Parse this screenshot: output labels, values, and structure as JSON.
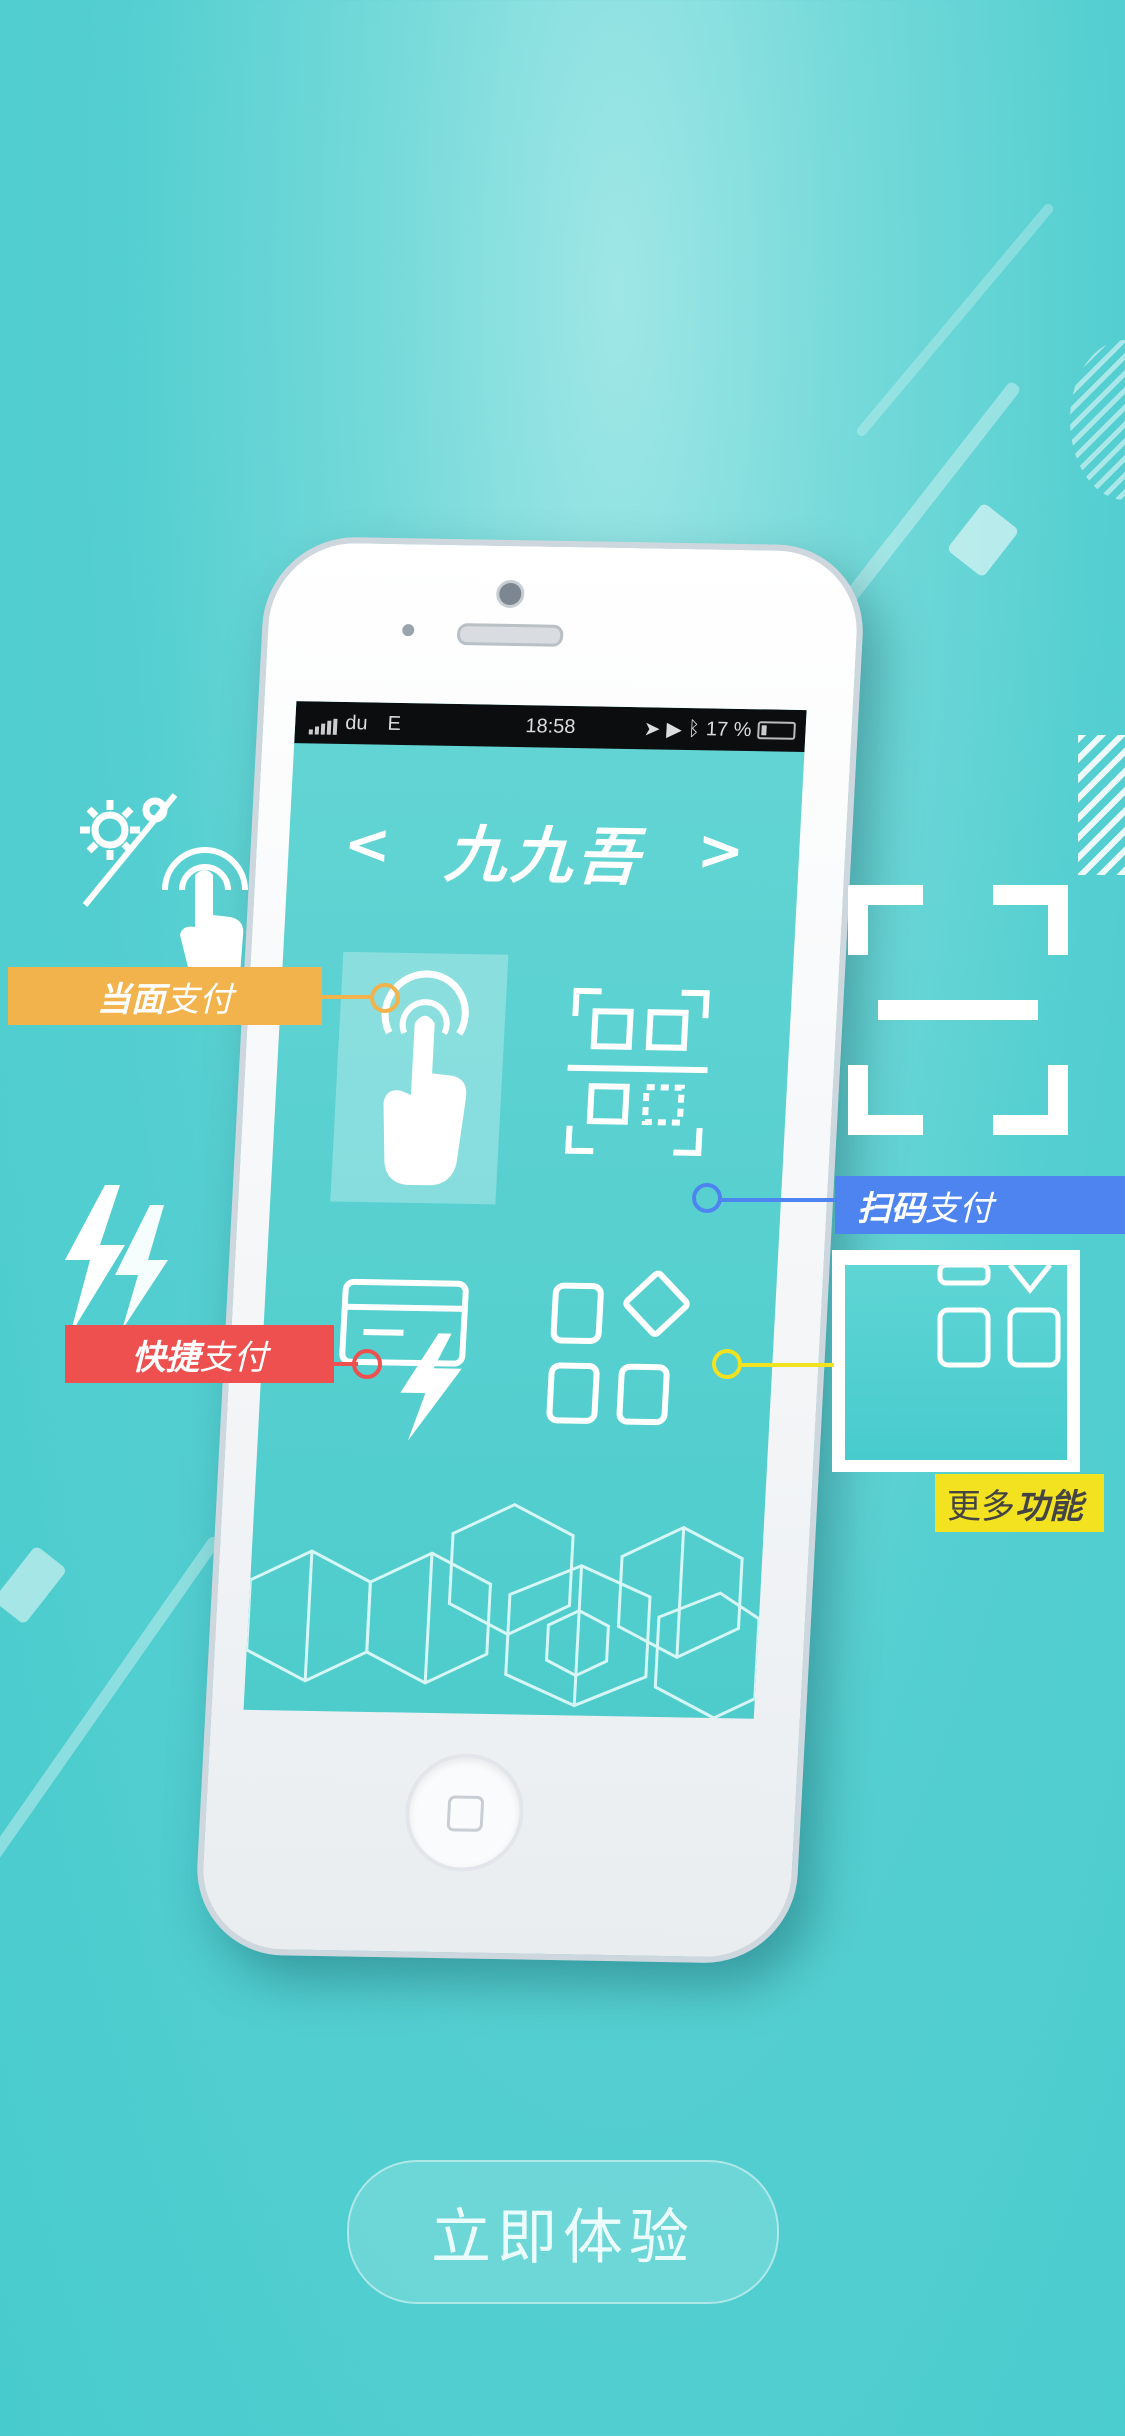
{
  "app": {
    "title": "九九吾",
    "prev_icon": "chevron-left-icon",
    "next_icon": "chevron-right-icon"
  },
  "status_bar": {
    "carrier": "du",
    "network": "E",
    "time": "18:58",
    "battery": "17 %"
  },
  "features": {
    "face_pay": {
      "strong": "当面",
      "normal": "支付",
      "color": "#f2b24c"
    },
    "scan_pay": {
      "strong": "扫码",
      "normal": "支付",
      "color": "#4e84f0"
    },
    "quick_pay": {
      "strong": "快捷",
      "normal": "支付",
      "color": "#ee4f4f"
    },
    "more": {
      "normal": "更多",
      "strong": "功能",
      "color": "#f2e21f"
    }
  },
  "cta": {
    "label": "立即体验"
  },
  "colors": {
    "background": "#4fcfd1",
    "face_pay_tag": "#f2b24c",
    "scan_pay_tag": "#4e84f0",
    "quick_pay_tag": "#ee4f4f",
    "more_tag": "#f2e21f"
  }
}
